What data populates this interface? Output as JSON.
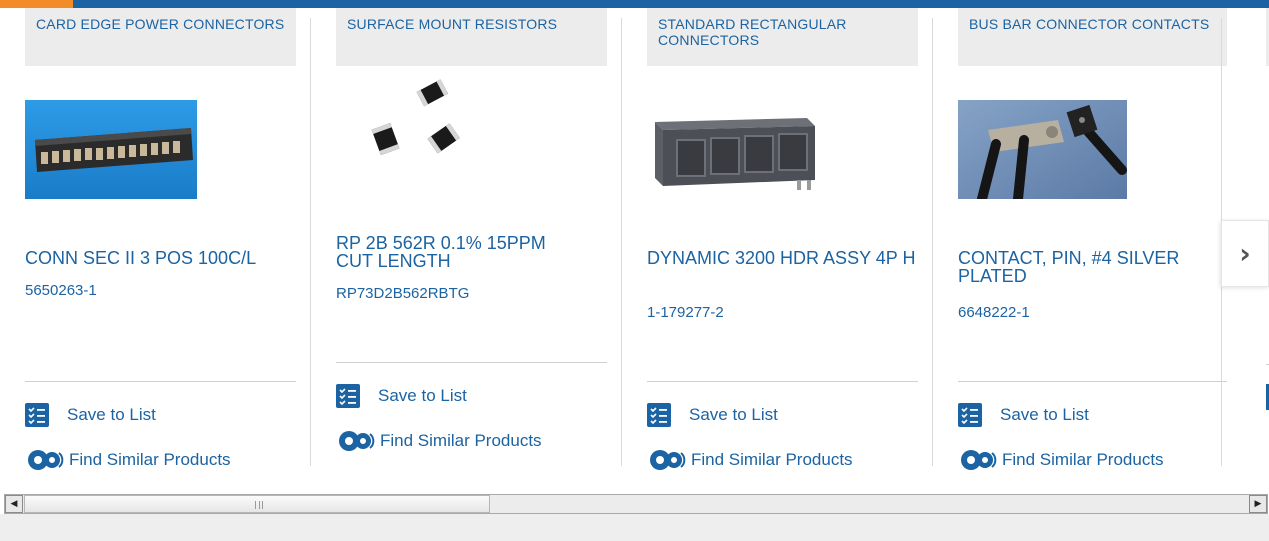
{
  "colors": {
    "brand": "#1b63a3",
    "accent": "#f28c28"
  },
  "cards": [
    {
      "category": "CARD EDGE POWER CONNECTORS",
      "image": "card-edge-connector-image",
      "title": "CONN SEC II 3 POS 100C/L",
      "part_number": "5650263-1",
      "save_label": "Save to List",
      "similar_label": "Find Similar Products"
    },
    {
      "category": "SURFACE MOUNT RESISTORS",
      "image": "smd-resistor-image",
      "title": "RP 2B 562R 0.1% 15PPM CUT LENGTH",
      "part_number": "RP73D2B562RBTG",
      "save_label": "Save to List",
      "similar_label": "Find Similar Products"
    },
    {
      "category": "STANDARD RECTANGULAR CONNECTORS",
      "image": "rectangular-connector-image",
      "title": "DYNAMIC 3200 HDR ASSY 4P H",
      "part_number": "1-179277-2",
      "save_label": "Save to List",
      "similar_label": "Find Similar Products"
    },
    {
      "category": "BUS BAR CONNECTOR CONTACTS",
      "image": "bus-bar-contact-image",
      "title": "CONTACT, PIN, #4 SILVER PLATED",
      "part_number": "6648222-1",
      "save_label": "Save to List",
      "similar_label": "Find Similar Products"
    }
  ],
  "carousel": {
    "next_icon": "chevron-right-icon",
    "next_glyph": "›"
  },
  "scrollbar": {
    "left_glyph": "◀",
    "right_glyph": "▶"
  }
}
